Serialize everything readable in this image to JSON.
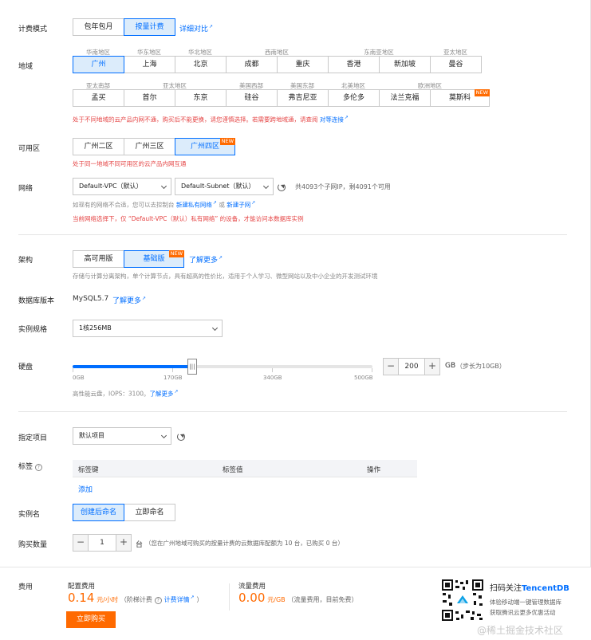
{
  "billing": {
    "label": "计费模式",
    "options": [
      "包年包月",
      "按量计费"
    ],
    "selected": 1,
    "compare": "详细对比"
  },
  "region": {
    "label": "地域",
    "row1_heads": [
      "华南地区",
      "华东地区",
      "华北地区",
      "西南地区",
      "",
      "东南亚地区",
      "",
      "亚太地区"
    ],
    "row1": [
      "广州",
      "上海",
      "北京",
      "成都",
      "重庆",
      "香港",
      "新加坡",
      "曼谷"
    ],
    "row2_heads": [
      "亚太南部",
      "亚太地区",
      "",
      "美国西部",
      "美国东部",
      "北美地区",
      "",
      "欧洲地区"
    ],
    "row2": [
      "孟买",
      "首尔",
      "东京",
      "硅谷",
      "弗吉尼亚",
      "多伦多",
      "法兰克福",
      "莫斯科"
    ],
    "new_badge": "NEW",
    "warning_text": "处于不同地域的云产品内网不通，购买后不能更换，请您谨慎选择。若需要跨地域通，请查阅",
    "warning_link": "对等连接"
  },
  "zone": {
    "label": "可用区",
    "options": [
      "广州二区",
      "广州三区",
      "广州四区"
    ],
    "selected": 2,
    "new_badge": "NEW",
    "warning": "处于同一地域不同可用区的云产品内网互通"
  },
  "network": {
    "label": "网络",
    "vpc": "Default-VPC（默认）",
    "subnet": "Default-Subnet（默认）",
    "info": "共4093个子网IP，剩4091个可用",
    "note_prefix": "如现有的网络不合适，您可以去控制台",
    "note_link1": "新建私有网络",
    "note_mid": "或",
    "note_link2": "新建子网",
    "warning": "当前网络选择下，仅 “Default-VPC（默认）私有网络” 的设备，才能访问本数据库实例"
  },
  "arch": {
    "label": "架构",
    "options": [
      "高可用版",
      "基础版"
    ],
    "selected": 1,
    "new_badge": "NEW",
    "more": "了解更多",
    "note": "存储与计算分离架构，单个计算节点，具有超高的性价比，适用于个人学习、微型网站以及中小企业的开发测试环境"
  },
  "dbver": {
    "label": "数据库版本",
    "value": "MySQL5.7",
    "more": "了解更多"
  },
  "spec": {
    "label": "实例规格",
    "value": "1核256MB"
  },
  "disk": {
    "label": "硬盘",
    "ticks": [
      "0GB",
      "170GB",
      "340GB",
      "500GB"
    ],
    "value": "200",
    "unit": "GB",
    "step_note": "（步长为10GB）",
    "min": 0,
    "max": 500,
    "current": 200,
    "minus": "−",
    "plus": "+",
    "note": "高性能云盘，IOPS：3100。",
    "more": "了解更多"
  },
  "project": {
    "label": "指定项目",
    "value": "默认项目"
  },
  "tags": {
    "label": "标签",
    "help": "?",
    "cols": [
      "标签键",
      "标签值",
      "操作"
    ],
    "add": "添加"
  },
  "instname": {
    "label": "实例名",
    "options": [
      "创建后命名",
      "立即命名"
    ],
    "selected": 0
  },
  "qty": {
    "label": "购买数量",
    "value": "1",
    "unit": "台",
    "minus": "−",
    "plus": "+",
    "note": "（您在广州地域可购买的按量计费的云数据库配额为 10 台，已购买 0 台）"
  },
  "footer": {
    "fee_label": "费用",
    "config_label": "配置费用",
    "price": "0.14",
    "price_unit": "元/小时",
    "tier": "（阶梯计费",
    "tier_help": "?",
    "tier_link": "计费详情",
    "tier_close": "）",
    "traffic_label": "流量费用",
    "traffic_price": "0.00",
    "traffic_unit": "元/GB",
    "traffic_note": "（流量费用，目前免费）",
    "buy": "立即购买",
    "qr_title": "扫码关注",
    "qr_brand": "TencentDB",
    "qr_sub1": "体验移动端一键管理数据库",
    "qr_sub2": "获取腾讯云更多优惠活动",
    "watermark": "@稀土掘金技术社区"
  },
  "colors": {
    "accent": "#006eff",
    "warning": "#e54545",
    "orange": "#ff6a00"
  }
}
